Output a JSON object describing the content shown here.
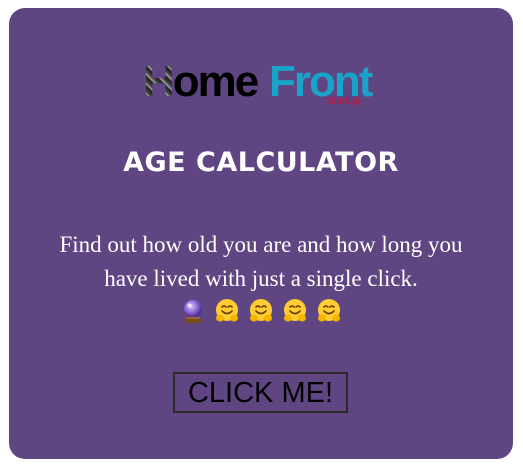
{
  "logo": {
    "home_first": "H",
    "home_rest": "ome",
    "front": "Front",
    "tagline": "StartUp"
  },
  "title": "AGE CALCULATOR",
  "description": "Find out how old you are and how long you have lived with just a single click.",
  "emojis": [
    "crystal-ball-icon",
    "hugging-face-icon",
    "hugging-face-icon",
    "hugging-face-icon",
    "hugging-face-icon"
  ],
  "button": {
    "label": "CLICK ME!"
  },
  "colors": {
    "card_background": "#5f4683",
    "logo_front": "#1aa3c9",
    "logo_tagline": "#c8102e",
    "text": "#ffffff"
  }
}
